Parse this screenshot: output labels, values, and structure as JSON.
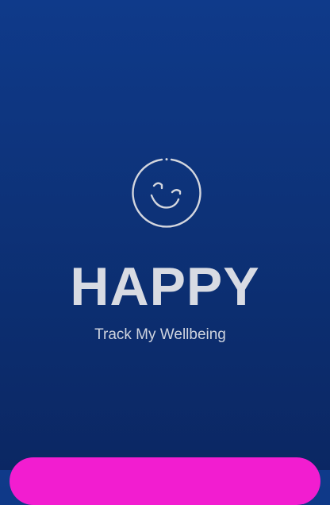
{
  "splash": {
    "logo_icon": "winking-smiley-icon",
    "title": "HAPPY",
    "tagline": "Track My Wellbeing"
  },
  "cta": {
    "label": "",
    "color": "#f21dd0"
  },
  "colors": {
    "background_top": "#0f3a8a",
    "background_bottom": "#0b2763",
    "text": "#d8dbe3"
  }
}
